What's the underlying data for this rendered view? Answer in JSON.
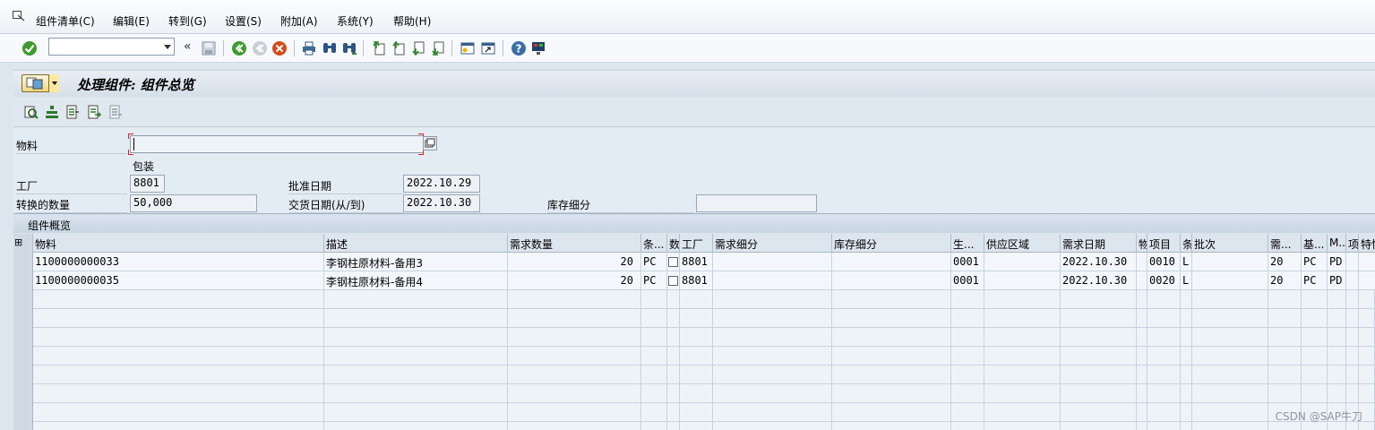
{
  "menubar": {
    "items": [
      "组件清单(C)",
      "编辑(E)",
      "转到(G)",
      "设置(S)",
      "附加(A)",
      "系统(Y)",
      "帮助(H)"
    ]
  },
  "toolbar": {
    "command_value": "",
    "icons": [
      "enter-icon",
      "save-icon",
      "back-icon",
      "exit-icon",
      "cancel-icon",
      "print-icon",
      "find-icon",
      "find-next-icon",
      "first-page-icon",
      "prev-page-icon",
      "next-page-icon",
      "last-page-icon",
      "new-session-icon",
      "shortcut-icon",
      "help-icon",
      "customize-layout-icon"
    ]
  },
  "title": "处理组件: 组件总览",
  "form": {
    "material_label": "物料",
    "material_value": "",
    "packaging_label": "包装",
    "plant_label": "工厂",
    "plant_value": "8801",
    "approve_date_label": "批准日期",
    "approve_date_value": "2022.10.29",
    "converted_qty_label": "转换的数量",
    "converted_qty_value": "50,000",
    "delivery_date_label": "交货日期(从/到)",
    "delivery_date_value": "2022.10.30",
    "stock_detail_label": "库存细分",
    "stock_detail_value": ""
  },
  "table": {
    "title": "组件概览",
    "select_all_glyph": "⊞",
    "headers": [
      "物料",
      "描述",
      "需求数量",
      "条...",
      "数",
      "工厂",
      "需求细分",
      "库存细分",
      "生...",
      "供应区域",
      "需求日期",
      "物",
      "项目",
      "条",
      "批次",
      "需...",
      "基...",
      "M...",
      "项",
      "特性"
    ],
    "rows": [
      [
        "1100000000033",
        "李钢柱原材料-备用3",
        "20",
        "PC",
        "",
        "8801",
        "",
        "",
        "0001",
        "",
        "2022.10.30",
        "",
        "0010",
        "L",
        "",
        "20",
        "PC",
        "PD",
        "",
        ""
      ],
      [
        "1100000000035",
        "李钢柱原材料-备用4",
        "20",
        "PC",
        "",
        "8801",
        "",
        "",
        "0001",
        "",
        "2022.10.30",
        "",
        "0020",
        "L",
        "",
        "20",
        "PC",
        "PD",
        "",
        ""
      ]
    ]
  },
  "watermark": "CSDN @SAP牛刀"
}
